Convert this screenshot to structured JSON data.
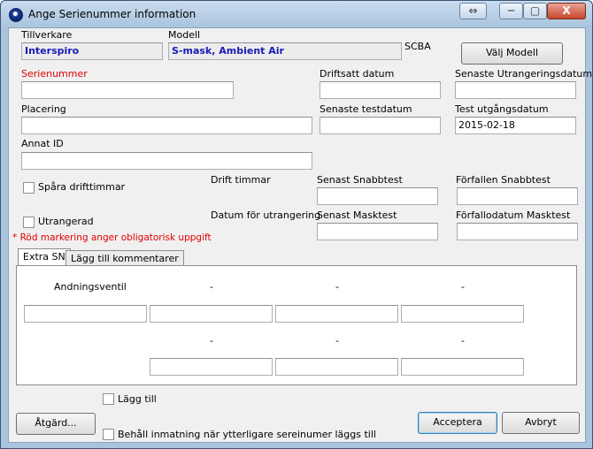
{
  "window": {
    "title": "Ange Serienummer information",
    "buttons": {
      "resize": "⇔",
      "minimize": "─",
      "maximize": "▢",
      "close": "X"
    }
  },
  "fields": {
    "tillverkare": {
      "label": "Tillverkare",
      "value": "Interspiro"
    },
    "modell": {
      "label": "Modell",
      "value": "S-mask, Ambient Air"
    },
    "scba": "SCBA",
    "serienummer": {
      "label": "Serienummer",
      "value": ""
    },
    "driftsatt": {
      "label": "Driftsatt datum",
      "value": ""
    },
    "senaste_utrangering": {
      "label": "Senaste Utrangeringsdatum",
      "value": ""
    },
    "placering": {
      "label": "Placering",
      "value": ""
    },
    "senaste_test": {
      "label": "Senaste testdatum",
      "value": ""
    },
    "test_utgang": {
      "label": "Test utgångsdatum",
      "value": "2015-02-18"
    },
    "annat_id": {
      "label": "Annat ID",
      "value": ""
    },
    "drift_timmar": {
      "label": "Drift timmar"
    },
    "senast_snabbtest": {
      "label": "Senast Snabbtest",
      "value": ""
    },
    "forfallen_snabbtest": {
      "label": "Förfallen Snabbtest",
      "value": ""
    },
    "datum_utrangering": {
      "label": "Datum för utrangering"
    },
    "senast_masktest": {
      "label": "Senast Masktest",
      "value": ""
    },
    "forfallodatum_masktest": {
      "label": "Förfallodatum Masktest",
      "value": ""
    }
  },
  "checkboxes": {
    "spara_drifttimmar": "Spåra drifttimmar",
    "utrangerad": "Utrangerad",
    "lagg_till": "Lägg till",
    "behall": "Behåll inmatning när ytterligare sereinumer läggs till"
  },
  "required_note": "* Röd markering anger obligatorisk uppgift",
  "buttons": {
    "valj_modell": "Välj Modell",
    "atgard": "Åtgärd...",
    "acceptera": "Acceptera",
    "avbryt": "Avbryt"
  },
  "tabs": [
    "Extra SN",
    "Lägg till kommentarer"
  ],
  "extra_sn": {
    "row1_labels": [
      "Andningsventil",
      "-",
      "-",
      "-"
    ],
    "row2_labels": [
      "-",
      "-",
      "-"
    ],
    "row1_values": [
      "",
      "",
      "",
      ""
    ],
    "row2_values": [
      "",
      "",
      ""
    ]
  },
  "colors": {
    "required": "#e00000",
    "readonly_text": "#1a1ab8",
    "title_bar": "#a9c4de"
  }
}
